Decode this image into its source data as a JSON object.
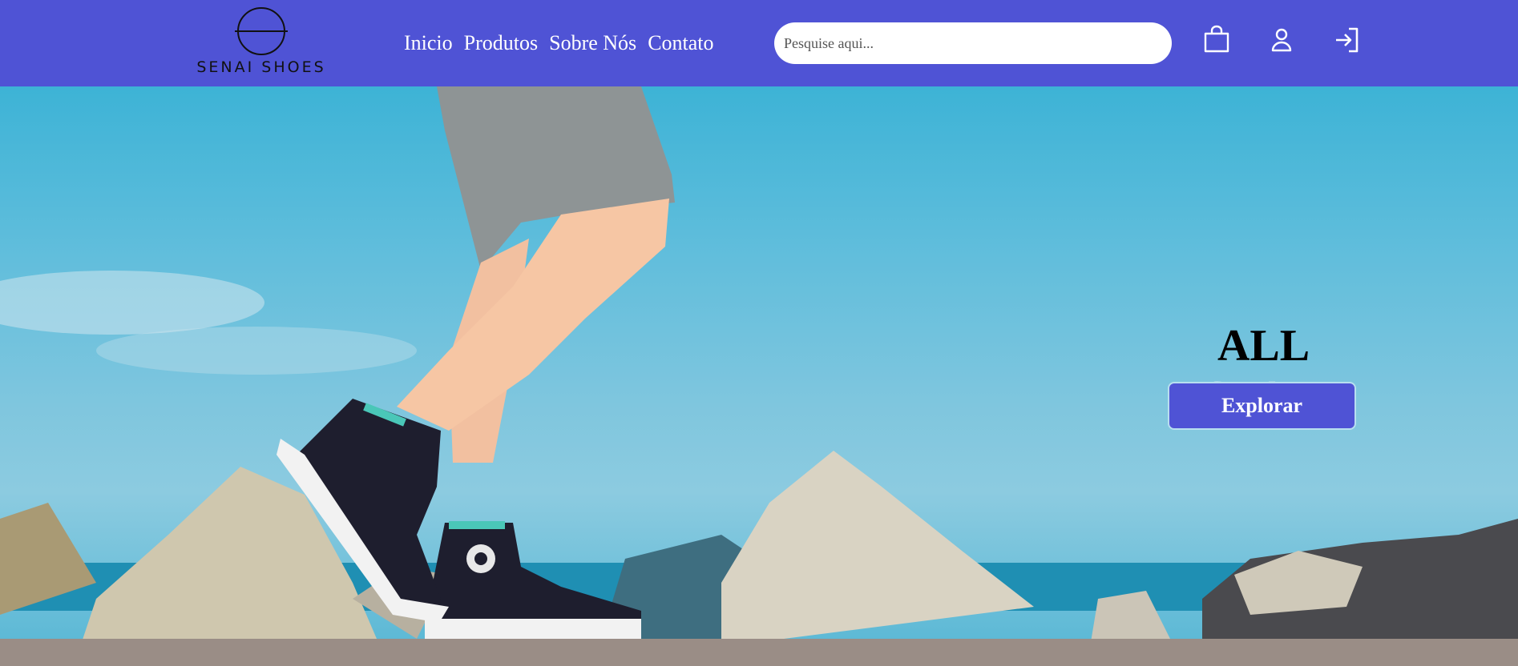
{
  "brand": {
    "name": "SENAI SHOES"
  },
  "nav": [
    {
      "label": "Inicio"
    },
    {
      "label": "Produtos"
    },
    {
      "label": "Sobre Nós"
    },
    {
      "label": "Contato"
    }
  ],
  "search": {
    "placeholder": "Pesquise aqui...",
    "value": ""
  },
  "header_icons": [
    "shopping-bag-icon",
    "user-icon",
    "login-icon"
  ],
  "hero": {
    "title_part1": "ALL",
    "title_part2": "STAR",
    "button_label": "Explorar",
    "image": "hero-sneakers-photo"
  },
  "colors": {
    "primary": "#4f53d5",
    "title_dark": "#000000",
    "title_light": "#e6f4f8"
  }
}
